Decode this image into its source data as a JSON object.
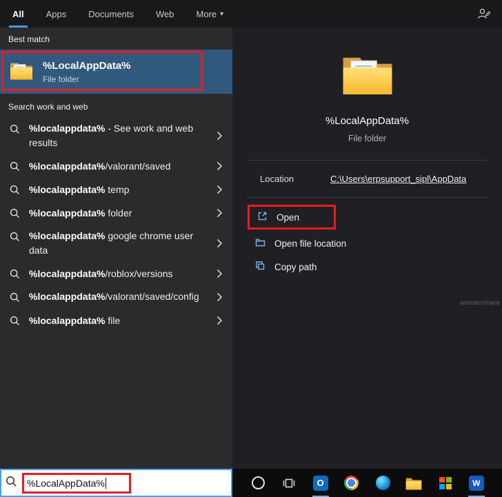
{
  "tabs": [
    {
      "label": "All",
      "active": true
    },
    {
      "label": "Apps"
    },
    {
      "label": "Documents"
    },
    {
      "label": "Web"
    },
    {
      "label": "More",
      "caret": "▾"
    }
  ],
  "left": {
    "best_match_header": "Best match",
    "best_match": {
      "title": "%LocalAppData%",
      "subtitle": "File folder",
      "icon": "folder-icon"
    },
    "search_web_header": "Search work and web",
    "suggestions": [
      {
        "bold": "%localappdata%",
        "rest": " - See work and web results",
        "icon": "search-icon"
      },
      {
        "bold": "%localappdata%",
        "rest": "/valorant/saved",
        "icon": "search-icon"
      },
      {
        "bold": "%localappdata%",
        "rest": " temp",
        "icon": "search-icon"
      },
      {
        "bold": "%localappdata%",
        "rest": " folder",
        "icon": "search-icon"
      },
      {
        "bold": "%localappdata%",
        "rest": " google chrome user data",
        "icon": "search-icon"
      },
      {
        "bold": "%localappdata%",
        "rest": "/roblox/versions",
        "icon": "search-icon"
      },
      {
        "bold": "%localappdata%",
        "rest": "/valorant/saved/config",
        "icon": "search-icon"
      },
      {
        "bold": "%localappdata%",
        "rest": " file",
        "icon": "search-icon"
      }
    ]
  },
  "right": {
    "title": "%LocalAppData%",
    "subtitle": "File folder",
    "icon": "folder-icon",
    "location_label": "Location",
    "location_value": "C:\\Users\\erpsupport_sipl\\AppData",
    "actions": [
      {
        "label": "Open",
        "icon": "open-icon",
        "annotated": true
      },
      {
        "label": "Open file location",
        "icon": "open-file-location-icon"
      },
      {
        "label": "Copy path",
        "icon": "copy-path-icon"
      }
    ]
  },
  "taskbar": {
    "search_value": "%LocalAppData%",
    "outlook_letter": "O",
    "word_letter": "W",
    "icons": [
      "search-icon",
      "cortana-icon",
      "task-view-icon",
      "outlook-icon",
      "chrome-icon",
      "edge-icon",
      "file-explorer-icon",
      "microsoft-logo-icon",
      "word-icon"
    ]
  },
  "colors": {
    "accent_blue": "#3f9fe0",
    "annotation_red": "#ea1c1c",
    "best_match_highlight": "#31597d",
    "left_panel": "#2b2b2e",
    "right_panel": "#202024",
    "taskbar_bg": "#0c0c0c"
  },
  "watermark": "wondershare"
}
